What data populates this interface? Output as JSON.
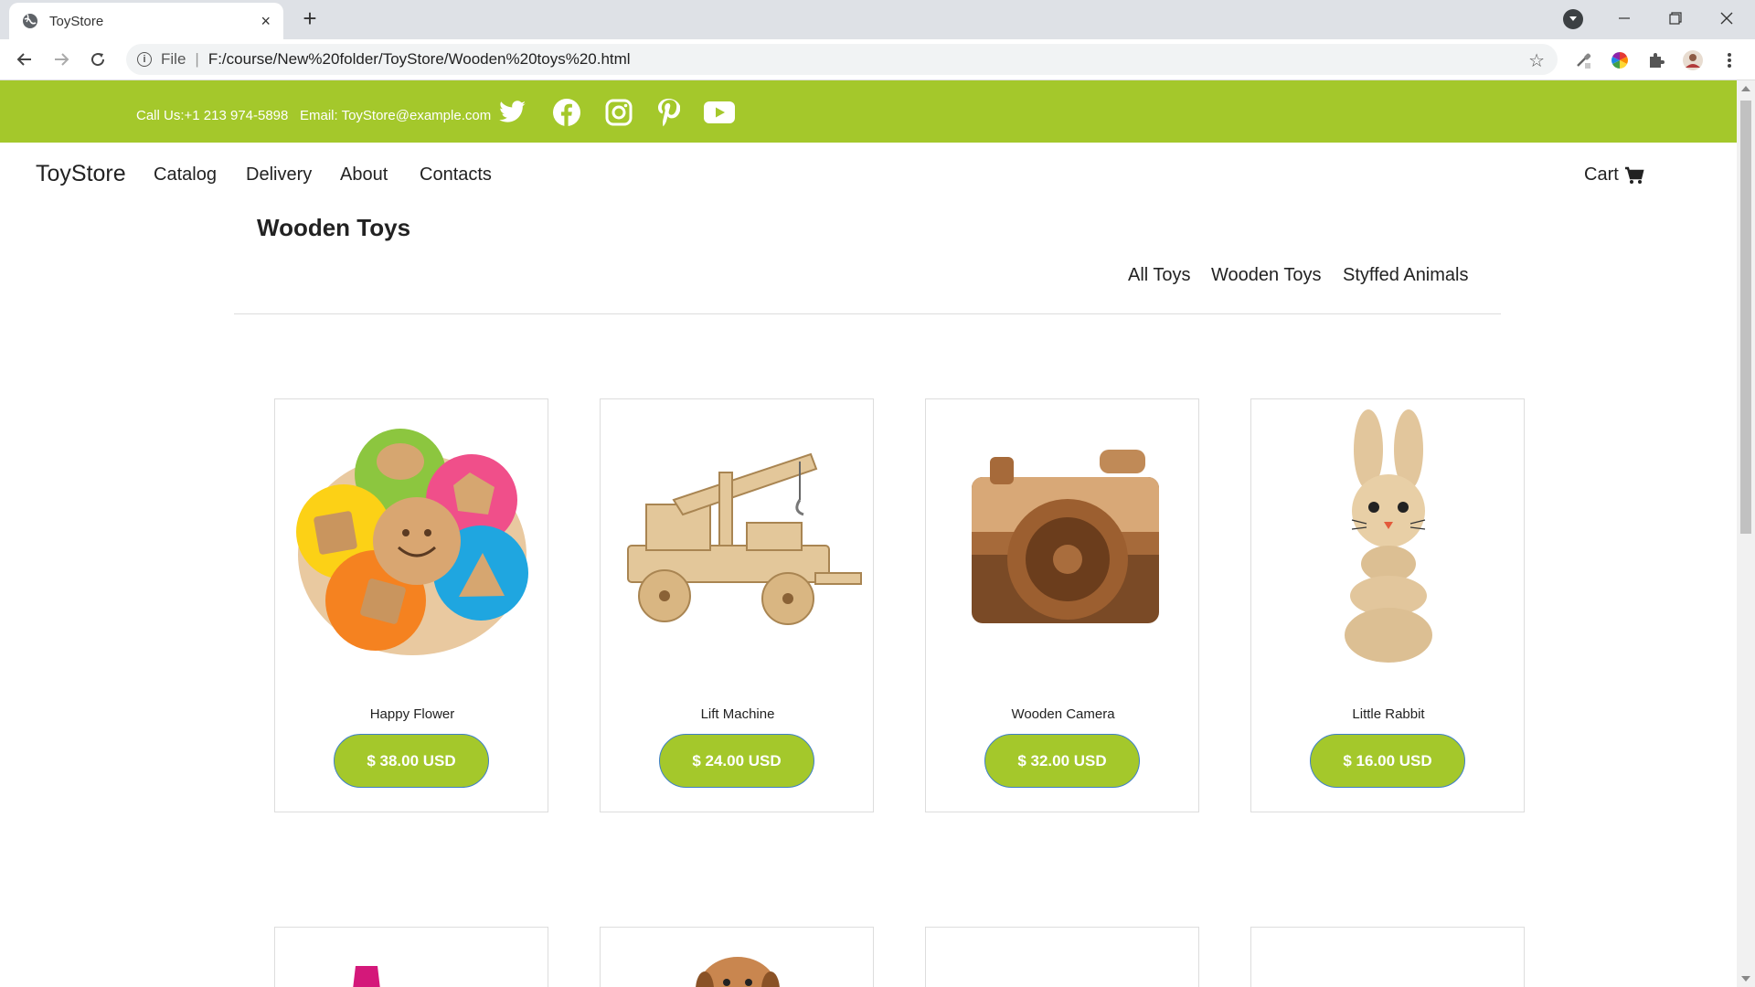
{
  "browser": {
    "tab_title": "ToyStore",
    "tab_close": "×",
    "new_tab": "+",
    "scheme": "File",
    "url": "F:/course/New%20folder/ToyStore/Wooden%20toys%20.html"
  },
  "topbar": {
    "phone": "Call Us:+1 213 974-5898",
    "email": "Email: ToyStore@example.com",
    "socials": [
      "twitter-icon",
      "facebook-icon",
      "instagram-icon",
      "pinterest-icon",
      "youtube-icon"
    ],
    "color": "#a4c82b"
  },
  "nav": {
    "brand": "ToyStore",
    "links": [
      "Catalog",
      "Delivery",
      "About",
      "Contacts"
    ],
    "cart": "Cart"
  },
  "main": {
    "title": "Wooden Toys",
    "filters": [
      "All Toys",
      "Wooden Toys",
      "Styffed Animals"
    ],
    "products": [
      {
        "name": "Happy Flower",
        "price": "$ 38.00 USD"
      },
      {
        "name": "Lift Machine",
        "price": "$ 24.00 USD"
      },
      {
        "name": "Wooden Camera",
        "price": "$ 32.00 USD"
      },
      {
        "name": "Little Rabbit",
        "price": "$ 16.00 USD"
      }
    ]
  }
}
